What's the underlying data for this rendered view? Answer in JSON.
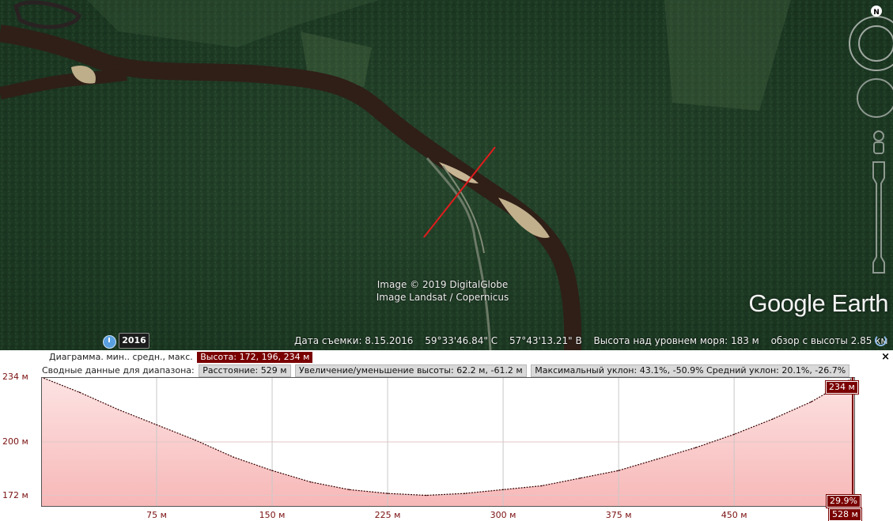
{
  "map": {
    "attribution_1": "Image © 2019 DigitalGlobe",
    "attribution_2": "Image Landsat / Copernicus",
    "logo": "Google Earth",
    "compass_label": "N",
    "year_button": "2016",
    "status": {
      "date": "Дата съемки: 8.15.2016",
      "lat": "59°33'46.84\" С",
      "lon": "57°43'13.21\" В",
      "elevation": "Высота над уровнем моря:   183 м",
      "eye_alt": "обзор с высоты   2.85 км"
    },
    "colors": {
      "forest": "#1f3a25",
      "river": "#3a2319",
      "path": "#e11c1c"
    }
  },
  "profile": {
    "close_label": "×",
    "row1_label": "Диаграмма. мин.. средн., макс.",
    "row1_value": "Высота: 172, 196, 234 м",
    "row2_label": "Сводные данные для диапазона:",
    "row2_distance": "Расстояние: 529 м",
    "row2_gain": "Увеличение/уменьшение высоты: 62.2 м, -61.2 м",
    "row2_slope": "Максимальный уклон: 43.1%, -50.9% Средний уклон: 20.1%, -26.7%",
    "tag_top": "234 м",
    "tag_slope": "29.9%",
    "tag_end": "528 м"
  },
  "chart_data": {
    "type": "area",
    "x": [
      0,
      25,
      50,
      75,
      100,
      125,
      150,
      175,
      200,
      225,
      250,
      275,
      300,
      325,
      350,
      375,
      400,
      425,
      450,
      475,
      500,
      528
    ],
    "values": [
      234,
      226,
      217,
      209,
      201,
      192,
      185,
      179,
      175,
      173,
      172,
      173,
      175,
      177,
      181,
      185,
      191,
      197,
      204,
      212,
      221,
      234
    ],
    "xlim": [
      0,
      528
    ],
    "ylim": [
      166,
      234
    ],
    "y_ticks": [
      "234 м",
      "200 м",
      "172 м"
    ],
    "y_tick_values": [
      234,
      200,
      172
    ],
    "x_ticks": [
      "75 м",
      "150 м",
      "225 м",
      "300 м",
      "375 м",
      "450 м",
      "528 м"
    ],
    "x_tick_values": [
      75,
      150,
      225,
      300,
      375,
      450
    ],
    "grid": true,
    "fill_color": "#f7b7b7",
    "line_color": "#3a0000"
  }
}
